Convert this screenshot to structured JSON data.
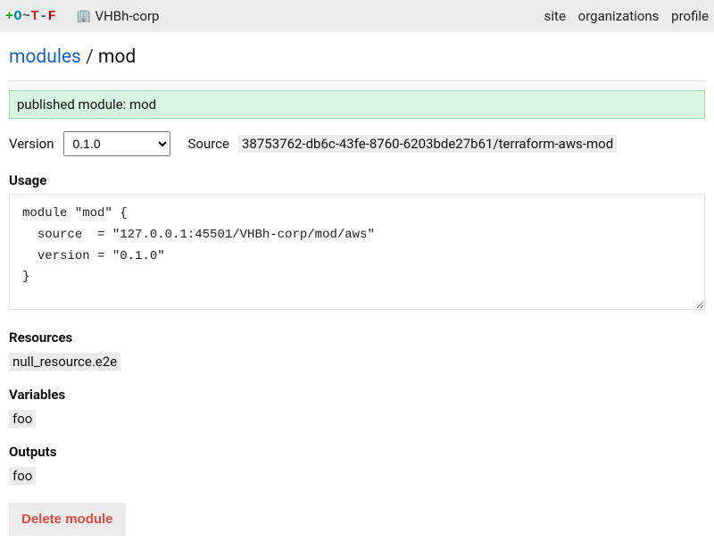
{
  "topbar": {
    "logo": {
      "plus": "+",
      "o": "O",
      "tilde": "~",
      "t": "T",
      "dash2": "-",
      "f": "F"
    },
    "org_name": "VHBh-corp",
    "nav": {
      "site": "site",
      "organizations": "organizations",
      "profile": "profile"
    }
  },
  "breadcrumb": {
    "modules_link": "modules",
    "sep": " / ",
    "current": "mod"
  },
  "flash": "published module: mod",
  "version": {
    "label": "Version",
    "selected": "0.1.0",
    "options": [
      "0.1.0"
    ]
  },
  "source": {
    "label": "Source",
    "path": "38753762-db6c-43fe-8760-6203bde27b61/terraform-aws-mod"
  },
  "usage": {
    "heading": "Usage",
    "code": "module \"mod\" {\n  source  = \"127.0.0.1:45501/VHBh-corp/mod/aws\"\n  version = \"0.1.0\"\n}"
  },
  "resources": {
    "heading": "Resources",
    "items": [
      "null_resource.e2e"
    ]
  },
  "variables": {
    "heading": "Variables",
    "items": [
      "foo"
    ]
  },
  "outputs": {
    "heading": "Outputs",
    "items": [
      "foo"
    ]
  },
  "delete_label": "Delete module"
}
